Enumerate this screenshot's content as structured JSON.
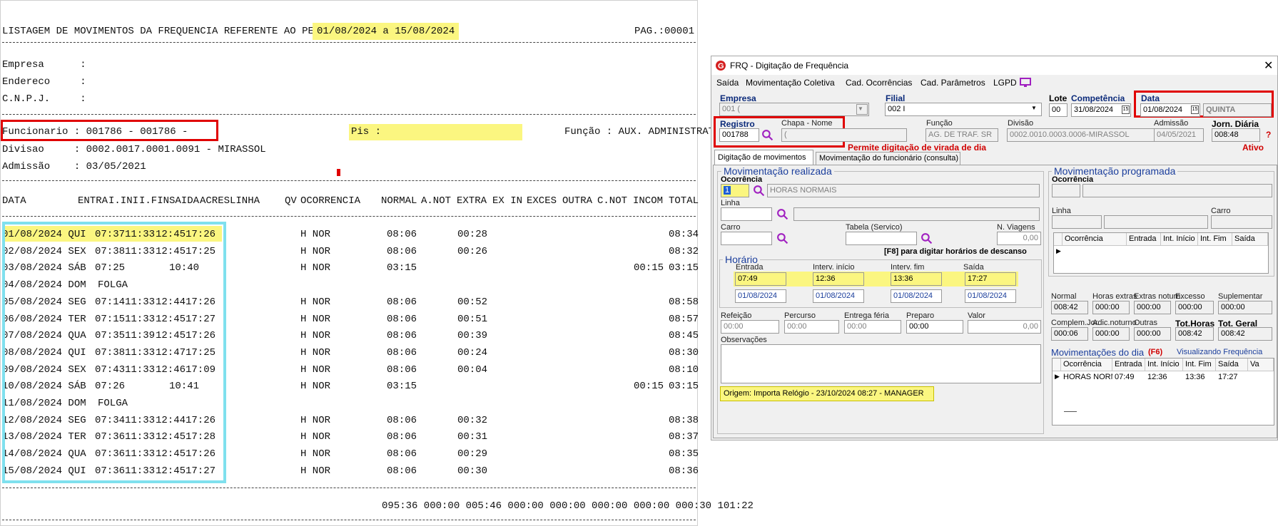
{
  "report": {
    "title_prefix": "LISTAGEM DE MOVIMENTOS DA FREQUENCIA REFERENTE AO PERIODO DE:",
    "period": "01/08/2024 a 15/08/2024",
    "page": "PAG.:00001",
    "empresa": "Empresa      :",
    "endereco": "Endereco     :",
    "cnpj": "C.N.P.J.     :",
    "funcionario": "Funcionario : 001786 - 001786 -",
    "pis": "Pis :",
    "funcao": "Função : AUX. ADMINISTRAT",
    "divisao": "Divisao     : 0002.0017.0001.0091 - MIRASSOL",
    "admissao": "Admissão    : 03/05/2021",
    "headers": [
      "DATA",
      "ENTRA",
      "I.INI",
      "I.FIN",
      "SAIDA",
      "ACRES",
      "LINHA",
      "QV",
      "OCORRENCIA",
      "NORMAL",
      "A.NOT",
      "EXTRA",
      "EX IN",
      "EXCES",
      "OUTRA",
      "C.NOT",
      "INCOM",
      "TOTAL"
    ],
    "rows": [
      {
        "data": "01/08/2024 QUI",
        "entra": "07:37",
        "iini": "11:33",
        "ifin": "12:45",
        "saida": "17:26",
        "ocor": "H NOR",
        "normal": "08:06",
        "extra": "00:28",
        "incom": "",
        "total": "08:34"
      },
      {
        "data": "02/08/2024 SEX",
        "entra": "07:38",
        "iini": "11:33",
        "ifin": "12:45",
        "saida": "17:25",
        "ocor": "H NOR",
        "normal": "08:06",
        "extra": "00:26",
        "incom": "",
        "total": "08:32"
      },
      {
        "data": "03/08/2024 SÁB",
        "entra": "07:25",
        "iini": "",
        "ifin": "10:40",
        "saida": "",
        "ocor": "H NOR",
        "normal": "03:15",
        "extra": "",
        "incom": "00:15",
        "total": "03:15"
      },
      {
        "data": "04/08/2024 DOM",
        "entra": "FOLGA",
        "iini": "",
        "ifin": "",
        "saida": "",
        "ocor": "",
        "normal": "",
        "extra": "",
        "incom": "",
        "total": ""
      },
      {
        "data": "05/08/2024 SEG",
        "entra": "07:14",
        "iini": "11:33",
        "ifin": "12:44",
        "saida": "17:26",
        "ocor": "H NOR",
        "normal": "08:06",
        "extra": "00:52",
        "incom": "",
        "total": "08:58"
      },
      {
        "data": "06/08/2024 TER",
        "entra": "07:15",
        "iini": "11:33",
        "ifin": "12:45",
        "saida": "17:27",
        "ocor": "H NOR",
        "normal": "08:06",
        "extra": "00:51",
        "incom": "",
        "total": "08:57"
      },
      {
        "data": "07/08/2024 QUA",
        "entra": "07:35",
        "iini": "11:39",
        "ifin": "12:45",
        "saida": "17:26",
        "ocor": "H NOR",
        "normal": "08:06",
        "extra": "00:39",
        "incom": "",
        "total": "08:45"
      },
      {
        "data": "08/08/2024 QUI",
        "entra": "07:38",
        "iini": "11:33",
        "ifin": "12:47",
        "saida": "17:25",
        "ocor": "H NOR",
        "normal": "08:06",
        "extra": "00:24",
        "incom": "",
        "total": "08:30"
      },
      {
        "data": "09/08/2024 SEX",
        "entra": "07:43",
        "iini": "11:33",
        "ifin": "12:46",
        "saida": "17:09",
        "ocor": "H NOR",
        "normal": "08:06",
        "extra": "00:04",
        "incom": "",
        "total": "08:10"
      },
      {
        "data": "10/08/2024 SÁB",
        "entra": "07:26",
        "iini": "",
        "ifin": "10:41",
        "saida": "",
        "ocor": "H NOR",
        "normal": "03:15",
        "extra": "",
        "incom": "00:15",
        "total": "03:15"
      },
      {
        "data": "11/08/2024 DOM",
        "entra": "FOLGA",
        "iini": "",
        "ifin": "",
        "saida": "",
        "ocor": "",
        "normal": "",
        "extra": "",
        "incom": "",
        "total": ""
      },
      {
        "data": "12/08/2024 SEG",
        "entra": "07:34",
        "iini": "11:33",
        "ifin": "12:44",
        "saida": "17:26",
        "ocor": "H NOR",
        "normal": "08:06",
        "extra": "00:32",
        "incom": "",
        "total": "08:38"
      },
      {
        "data": "13/08/2024 TER",
        "entra": "07:36",
        "iini": "11:33",
        "ifin": "12:45",
        "saida": "17:28",
        "ocor": "H NOR",
        "normal": "08:06",
        "extra": "00:31",
        "incom": "",
        "total": "08:37"
      },
      {
        "data": "14/08/2024 QUA",
        "entra": "07:36",
        "iini": "11:33",
        "ifin": "12:45",
        "saida": "17:26",
        "ocor": "H NOR",
        "normal": "08:06",
        "extra": "00:29",
        "incom": "",
        "total": "08:35"
      },
      {
        "data": "15/08/2024 QUI",
        "entra": "07:36",
        "iini": "11:33",
        "ifin": "12:45",
        "saida": "17:27",
        "ocor": "H NOR",
        "normal": "08:06",
        "extra": "00:30",
        "incom": "",
        "total": "08:36"
      }
    ],
    "totals": "095:36 000:00 005:46 000:00 000:00 000:00 000:00 000:30 101:22"
  },
  "window": {
    "title": "FRQ - Digitação de Frequência",
    "close": "✕",
    "menu": [
      "Saída",
      "Movimentação Coletiva",
      "Cad. Ocorrências",
      "Cad. Parâmetros",
      "LGPD"
    ],
    "empresa_label": "Empresa",
    "empresa_value": "001 (",
    "filial_label": "Filial",
    "filial_value": "002 I",
    "lote_label": "Lote",
    "lote_value": "00",
    "competencia_label": "Competência",
    "competencia_value": "31/08/2024",
    "data_label": "Data",
    "data_value": "01/08/2024",
    "dia_semana": "QUINTA",
    "registro_label": "Registro",
    "registro_value": "001788",
    "chapa_label": "Chapa - Nome",
    "chapa_value": "(",
    "funcao_label": "Função",
    "funcao_value": "AG. DE TRAF. SR",
    "divisao_label": "Divisão",
    "divisao_value": "0002.0010.0003.0006-MIRASSOL",
    "admissao_label": "Admissão",
    "admissao_value": "04/05/2021",
    "jorn_label": "Jorn. Diária",
    "jorn_value": "008:48",
    "help": "?",
    "permite": "Permite digitação de virada de dia",
    "ativo": "Ativo",
    "tabs": [
      "Digitação de movimentos",
      "Movimentação do funcionário (consulta)"
    ],
    "mov_realizada": "Movimentação realizada",
    "ocorrencia_label": "Ocorrência",
    "ocorrencia_code": "1",
    "ocorrencia_desc": "HORAS NORMAIS",
    "linha_label": "Linha",
    "carro_label": "Carro",
    "tabela_label": "Tabela (Servico)",
    "nviagens_label": "N. Viagens",
    "nviagens_value": "0,00",
    "f8_text": "[F8] para digitar horários de descanso",
    "horario_title": "Horário",
    "entrada_label": "Entrada",
    "iini_label": "Interv. início",
    "ifim_label": "Interv. fim",
    "saida_label": "Saída",
    "entrada_value": "07:49",
    "iini_value": "12:36",
    "ifim_value": "13:36",
    "saida_value": "17:27",
    "entrada_date": "01/08/2024",
    "iini_date": "01/08/2024",
    "ifim_date": "01/08/2024",
    "saida_date": "01/08/2024",
    "refeicao_label": "Refeição",
    "percurso_label": "Percurso",
    "entrega_label": "Entrega féria",
    "preparo_label": "Preparo",
    "valor_label": "Valor",
    "refeicao_value": "00:00",
    "percurso_value": "00:00",
    "entrega_value": "00:00",
    "preparo_value": "00:00",
    "valor_value": "0,00",
    "obs_label": "Observações",
    "origem": "Origem: Importa Relógio - 23/10/2024 08:27 - MANAGER",
    "mov_programada": "Movimentação programada",
    "prog_ocorrencia_label": "Ocorrência",
    "prog_linha_label": "Linha",
    "prog_carro_label": "Carro",
    "prog_headers": [
      "Ocorrência",
      "Entrada",
      "Int. Início",
      "Int. Fim",
      "Saída"
    ],
    "totals_labels_1": [
      "Normal",
      "Horas extras",
      "Extras noturn.",
      "Excesso",
      "Suplementar"
    ],
    "totals_values_1": [
      "008:42",
      "000:00",
      "000:00",
      "000:00",
      "000:00"
    ],
    "totals_labels_2": [
      "Complem.Jor.",
      "Adic.noturno",
      "Outras",
      "Tot.Horas",
      "Tot. Geral"
    ],
    "totals_values_2": [
      "000:06",
      "000:00",
      "000:00",
      "008:42",
      "008:42"
    ],
    "mov_dia_title": "Movimentações do dia",
    "f6": "(F6)",
    "visualizando": "Visualizando Frequência",
    "dia_headers": [
      "Ocorrência",
      "Entrada",
      "Int. Início",
      "Int. Fim",
      "Saída",
      "Va"
    ],
    "dia_row": [
      "HORAS NORM",
      "07:49",
      "12:36",
      "13:36",
      "17:27",
      ""
    ]
  }
}
